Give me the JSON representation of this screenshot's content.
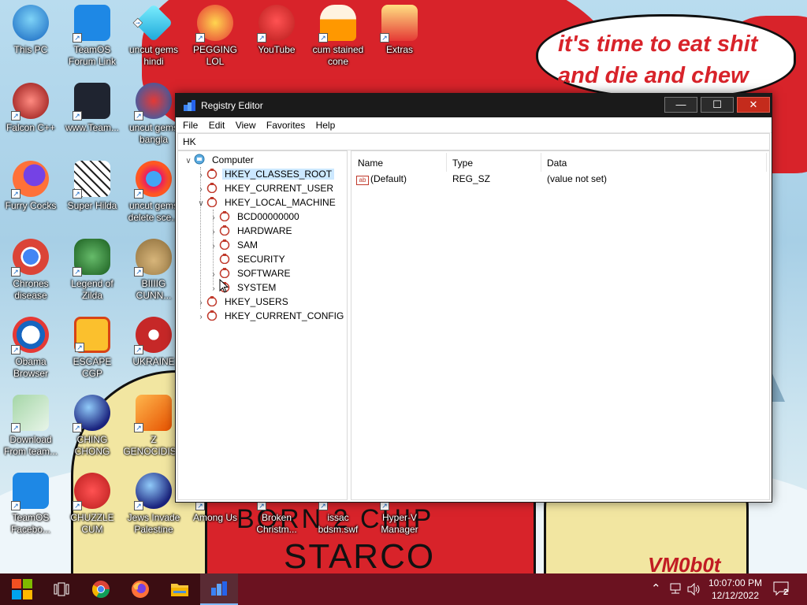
{
  "wallpaper": {
    "bubble_text": "it's time to eat shit and die and chew",
    "shirt_text_top": "BORN 2 CHIP",
    "shirt_text": "STARCO",
    "signature": "VM0b0t"
  },
  "desktop_icons": [
    {
      "label": "This PC",
      "icon": "computer-icon"
    },
    {
      "label": "TeamOS\nForum Link",
      "icon": "gear-icon"
    },
    {
      "label": "uncut gems\nhindi",
      "icon": "diamond-icon"
    },
    {
      "label": "PEGGING LOL",
      "icon": "p-badge-icon"
    },
    {
      "label": "YouTube",
      "icon": "angry-bird-icon"
    },
    {
      "label": "cum stained\ncone",
      "icon": "cone-icon"
    },
    {
      "label": "Extras",
      "icon": "folder-icon"
    },
    {
      "label": "Falcon C++",
      "icon": "falcon-icon"
    },
    {
      "label": "www.Team...",
      "icon": "book-icon"
    },
    {
      "label": "uncut gems\nbangla",
      "icon": "two-icon"
    },
    {
      "label": "Furry Cocks",
      "icon": "firefox-icon"
    },
    {
      "label": "Super Hilda",
      "icon": "pixel-icon"
    },
    {
      "label": "uncut gems\ndelete sce...",
      "icon": "gem-ring-icon"
    },
    {
      "label": "Chrones\ndisease",
      "icon": "chrome-icon"
    },
    {
      "label": "Legend of\nZilda",
      "icon": "zelda-icon"
    },
    {
      "label": "BIIIIG CUNN...",
      "icon": "money-bag-icon"
    },
    {
      "label": "Obama\nBrowser",
      "icon": "obama-logo-icon"
    },
    {
      "label": "ESCAPE CGP",
      "icon": "mahjong-icon"
    },
    {
      "label": "UKRAINE",
      "icon": "radiation-icon"
    },
    {
      "label": "Download\nFrom team...",
      "icon": "notepad-icon"
    },
    {
      "label": "CHING\nCHONG",
      "icon": "orb-icon"
    },
    {
      "label": "Z\nGENOCIDIS...",
      "icon": "blocks-icon"
    },
    {
      "label": "TeamOS\nFacebo...",
      "icon": "gear-icon"
    },
    {
      "label": "CHUZZLE\nCUM",
      "icon": "chuzzle-icon"
    },
    {
      "label": "Jews Invade\nPalestine",
      "icon": "orb-icon"
    },
    {
      "label": "Among Us",
      "icon": "among-us-icon"
    },
    {
      "label": "Broken\nChristm...",
      "icon": "file-icon"
    },
    {
      "label": "issac\nbdsm.swf",
      "icon": "swf-icon"
    },
    {
      "label": "Hyper-V\nManager",
      "icon": "hyperv-icon"
    }
  ],
  "window": {
    "title": "Registry Editor",
    "menu": [
      "File",
      "Edit",
      "View",
      "Favorites",
      "Help"
    ],
    "address": "HK",
    "tree": {
      "root": "Computer",
      "hives": [
        "HKEY_CLASSES_ROOT",
        "HKEY_CURRENT_USER",
        "HKEY_LOCAL_MACHINE"
      ],
      "hklm_children": [
        "BCD00000000",
        "HARDWARE",
        "SAM",
        "SECURITY",
        "SOFTWARE",
        "SYSTEM"
      ],
      "hives_after": [
        "HKEY_USERS",
        "HKEY_CURRENT_CONFIG"
      ],
      "selected": "HKEY_CLASSES_ROOT"
    },
    "columns": [
      "Name",
      "Type",
      "Data"
    ],
    "rows": [
      {
        "name": "(Default)",
        "type": "REG_SZ",
        "data": "(value not set)"
      }
    ]
  },
  "taskbar": {
    "time": "10:07:00 PM",
    "date": "12/12/2022",
    "notification_count": "2"
  },
  "colors": {
    "accent": "#cce8ff",
    "taskbar_bg": "#3b0d12",
    "close_button": "#c42b1c",
    "bubble_text": "#d8232a"
  }
}
